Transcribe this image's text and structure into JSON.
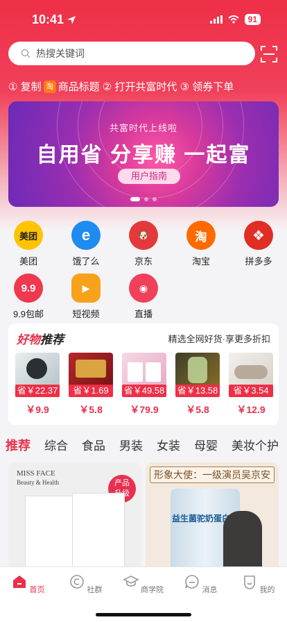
{
  "status": {
    "time": "10:41",
    "battery": "91"
  },
  "search": {
    "placeholder": "热搜关键词"
  },
  "steps": {
    "s1": "① 复制",
    "tao": "淘",
    "s2": "商品标题 ② 打开共富时代 ③ 领券下单"
  },
  "banner": {
    "subtitle": "共富时代上线啦",
    "title": "自用省 分享赚 一起富",
    "button": "用户指南"
  },
  "grid": [
    {
      "label": "美团",
      "icon": "meituan-icon",
      "color": "#ffc300",
      "glyph": "美团"
    },
    {
      "label": "饿了么",
      "icon": "eleme-icon",
      "color": "#1e8bf1",
      "glyph": "e"
    },
    {
      "label": "京东",
      "icon": "jd-icon",
      "color": "#e4393c",
      "glyph": "🐶"
    },
    {
      "label": "淘宝",
      "icon": "taobao-icon",
      "color": "#ff6a00",
      "glyph": "淘"
    },
    {
      "label": "拼多多",
      "icon": "pinduoduo-icon",
      "color": "#e02e24",
      "glyph": "❖"
    },
    {
      "label": "9.9包邮",
      "icon": "nine-nine-icon",
      "color": "#f0384f",
      "glyph": "9.9"
    },
    {
      "label": "短视频",
      "icon": "short-video-icon",
      "color": "#f7a21b",
      "glyph": "▶"
    },
    {
      "label": "直播",
      "icon": "live-icon",
      "color": "#f0405a",
      "glyph": "◉"
    }
  ],
  "recommend": {
    "title_a": "好物",
    "title_b": "推荐",
    "desc": "精选全网好货·享更多折扣",
    "products": [
      {
        "save": "省￥22.37",
        "price": "￥9.9"
      },
      {
        "save": "省￥1.69",
        "price": "￥5.8"
      },
      {
        "save": "省￥49.58",
        "price": "￥79.9"
      },
      {
        "save": "省￥13.58",
        "price": "￥5.8"
      },
      {
        "save": "省￥3.54",
        "price": "￥12.9"
      }
    ]
  },
  "tabs": [
    "推荐",
    "综合",
    "食品",
    "男装",
    "女装",
    "母婴",
    "美妆个护"
  ],
  "cards": {
    "c1": {
      "brand_a": "MISS FACE",
      "brand_b": "Beauty & Health",
      "badge_a": "产品",
      "badge_b": "升级"
    },
    "c2": {
      "ambassador": "形象大使：一级演员吴京安",
      "product": "益生菌驼奶蛋白粉"
    }
  },
  "tabbar": [
    {
      "label": "首页",
      "icon": "home-icon"
    },
    {
      "label": "社群",
      "icon": "community-icon"
    },
    {
      "label": "商学院",
      "icon": "academy-icon"
    },
    {
      "label": "消息",
      "icon": "message-icon"
    },
    {
      "label": "我的",
      "icon": "profile-icon"
    }
  ]
}
